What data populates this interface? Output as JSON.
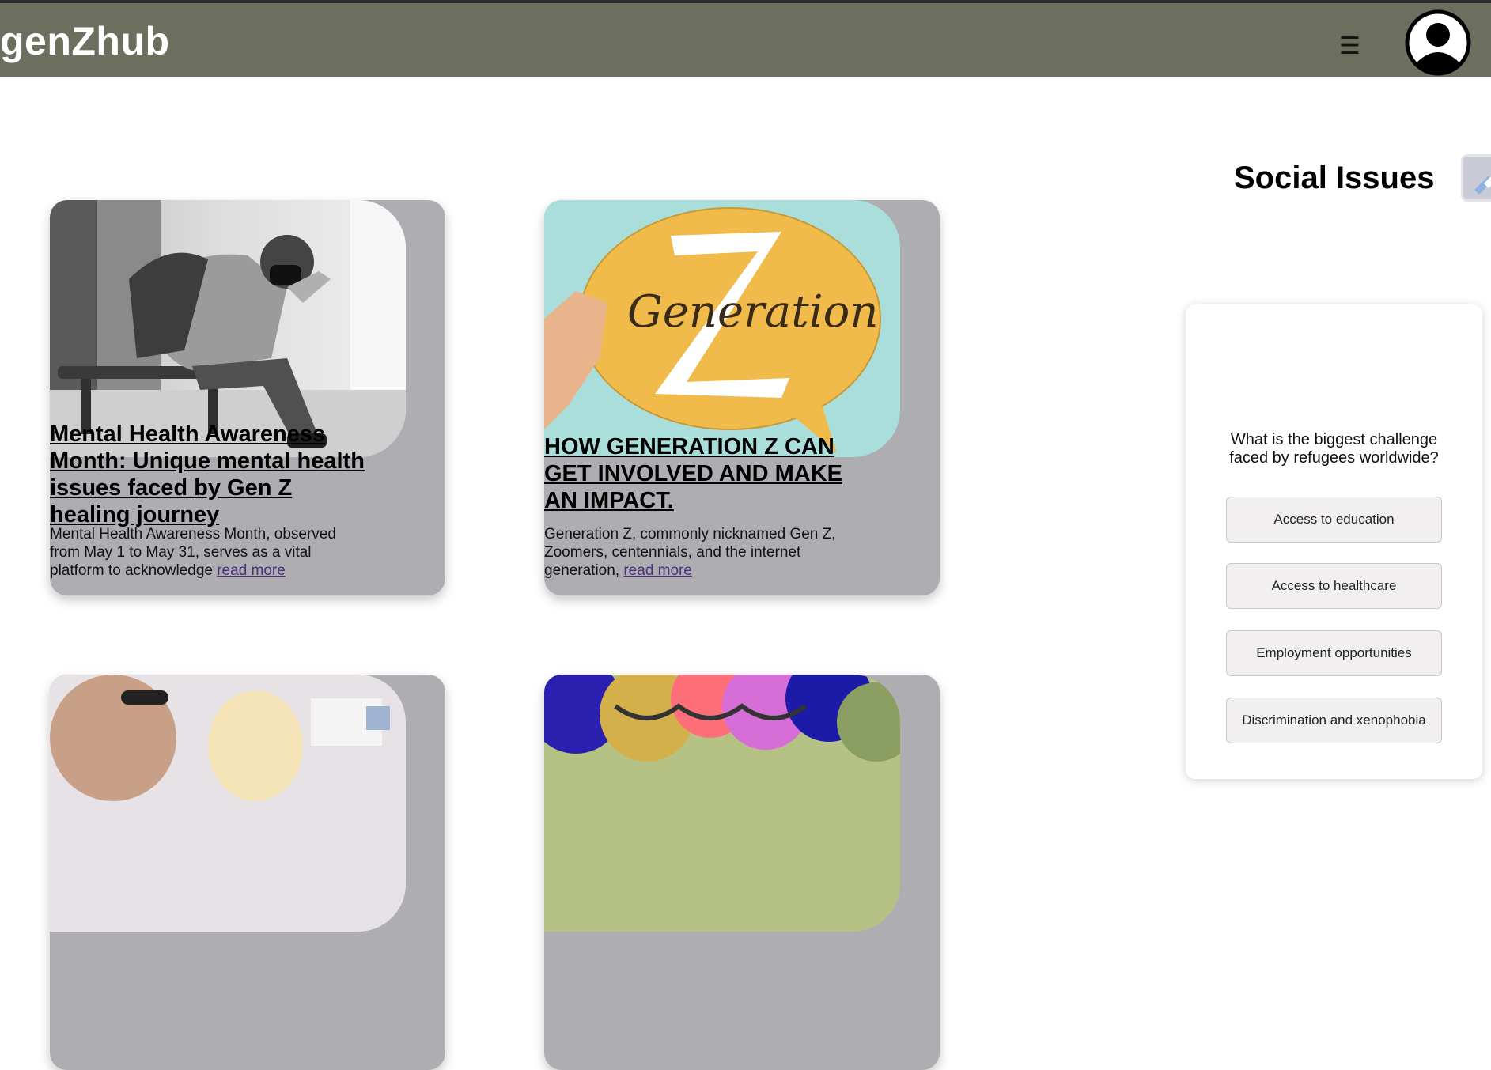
{
  "header": {
    "logo": "genZhub",
    "menu_icon": "☰",
    "colors": {
      "bar": "#6d6f5e",
      "logo": "#ffffff"
    }
  },
  "section": {
    "title": "Social Issues"
  },
  "articles": [
    {
      "title": "Mental Health Awareness Month: Unique mental health issues faced by Gen Z healing journey",
      "excerpt": "Mental Health Awareness Month, observed from May 1 to May 31, serves as a vital platform to acknowledge ",
      "link": "read more"
    },
    {
      "title": "HOW GENERATION Z CAN GET INVOLVED AND MAKE AN IMPACT.",
      "excerpt": "Generation Z, commonly nicknamed Gen Z, Zoomers, centennials, and the internet generation, ",
      "link": "read more",
      "image_text": "Generation"
    }
  ],
  "poll": {
    "question": "What is the biggest challenge faced by refugees worldwide?",
    "options": [
      "Access to education",
      "Access to healthcare",
      "Employment opportunities",
      "Discrimination and xenophobia"
    ]
  }
}
